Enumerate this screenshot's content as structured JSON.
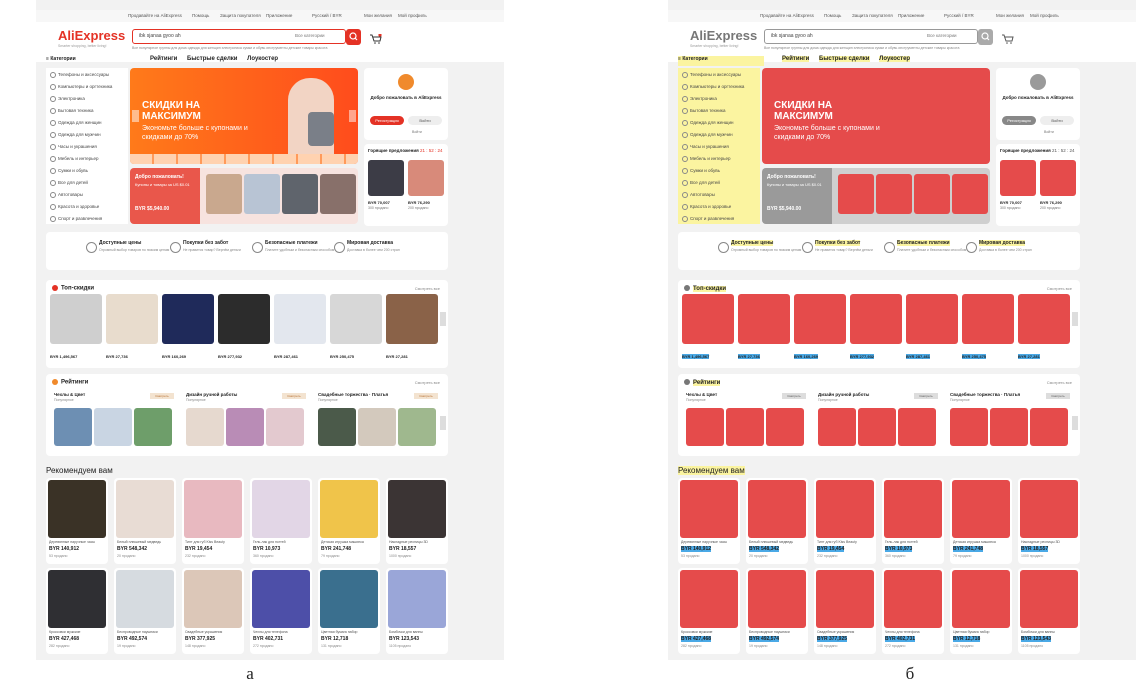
{
  "captions": {
    "a": "а",
    "b": "б"
  },
  "topbar": {
    "items": [
      "Продавайте на AliExpress",
      "Помощь",
      "Защита покупателя",
      "Приложение",
      "Русский / BYR",
      "Мои желания",
      "Мой профиль"
    ]
  },
  "header": {
    "logo": "AliExpress",
    "tagline": "Smarter shopping, better living!",
    "search_value": "ibk sjanaa gyoo ah",
    "search_category": "Все категории",
    "hints": "Все популярное  группы для дома  одежда для женщин  электроника  сумки и обувь  инструменты  детские товары  красота"
  },
  "categories": {
    "title": "Категории",
    "items": [
      "Телефоны и аксессуары",
      "Компьютеры и оргтехника",
      "Электроника",
      "Бытовая техника",
      "Одежда для женщин",
      "Одежда для мужчин",
      "Часы и украшения",
      "Мебель и интерьер",
      "Сумки и обувь",
      "Все для детей",
      "Автотовары",
      "Красота и здоровье",
      "Спорт и развлечения"
    ]
  },
  "tabs": [
    "Рейтинги",
    "Быстрые сделки",
    "Лоукостер"
  ],
  "banner": {
    "title": "СКИДКИ НА МАКСИМУМ",
    "subtitle": "Экономьте больше с купонами и скидками до 70%"
  },
  "welcome_promo": {
    "title": "Добро пожаловать!",
    "subtitle": "Купоны и товары за US $0.01",
    "price_currency": "BYR",
    "price": "$5,940.00"
  },
  "user": {
    "welcome": "Добро пожаловать в AliExpress",
    "register": "Регистрация",
    "login": "Войти",
    "other": "Войти"
  },
  "deals": {
    "title": "Горящие предложения",
    "timer": "21 : 52 : 24",
    "items": [
      {
        "price": "BYR 70,007",
        "sold": "300 продано"
      },
      {
        "price": "BYR 76,290",
        "sold": "200 продано"
      }
    ]
  },
  "features": [
    {
      "title": "Доступные цены",
      "desc": "Огромный выбор товаров по низким ценам"
    },
    {
      "title": "Покупки без забот",
      "desc": "Не нравится товар? Вернём деньги"
    },
    {
      "title": "Безопасные платежи",
      "desc": "Платите удобным и безопасным способом"
    },
    {
      "title": "Мировая доставка",
      "desc": "Доставка в более чем 200 стран"
    }
  ],
  "top_discounts": {
    "title": "Топ-скидки",
    "show_all": "Смотреть все",
    "prices": [
      "BYR 1,496,567",
      "BYR 27,736",
      "BYR 160,269",
      "BYR 277,932",
      "BYR 287,461",
      "BYR 250,475",
      "BYR 27,281"
    ]
  },
  "ratings": {
    "title": "Рейтинги",
    "show_all": "Смотреть все",
    "cards": [
      {
        "title": "Чехлы & Цвет",
        "sub": "Популярное"
      },
      {
        "title": "Дизайн ручной работы",
        "sub": "Популярное"
      },
      {
        "title": "Свадебные торжества · Платья",
        "sub": "Популярное"
      }
    ],
    "badge": "Смотреть"
  },
  "recommended": {
    "title": "Рекомендуем вам",
    "row1": [
      {
        "name": "Деревянные наручные часы",
        "price": "BYR 140,912",
        "sold": "53 продано"
      },
      {
        "name": "Белый плюшевый медведь",
        "price": "BYR 548,342",
        "sold": "20 продано"
      },
      {
        "name": "Тинт для губ Kiss Beauty",
        "price": "BYR 19,454",
        "sold": "232 продано"
      },
      {
        "name": "Гель-лак для ногтей",
        "price": "BYR 10,973",
        "sold": "360 продано"
      },
      {
        "name": "Детская игрушка машинка",
        "price": "BYR 241,748",
        "sold": "79 продано"
      },
      {
        "name": "Накладные ресницы 3D",
        "price": "BYR 18,557",
        "sold": "1000 продано"
      }
    ],
    "row2": [
      {
        "name": "Кроссовки мужские",
        "price": "BYR 427,468",
        "sold": "282 продано"
      },
      {
        "name": "Беспроводные наушники",
        "price": "BYR 492,574",
        "sold": "19 продано"
      },
      {
        "name": "Свадебные украшения",
        "price": "BYR 377,925",
        "sold": "148 продано"
      },
      {
        "name": "Чехлы для телефона",
        "price": "BYR 402,731",
        "sold": "272 продано"
      },
      {
        "name": "Цветная бумага набор",
        "price": "BYR 12,718",
        "sold": "131 продано"
      },
      {
        "name": "Бомбочки для ванны",
        "price": "BYR 123,543",
        "sold": "1105 продано"
      }
    ]
  },
  "colors": {
    "brand": "#e43225",
    "overlay_red": "#e54b4b",
    "overlay_yellow": "#fbf4a0",
    "overlay_blue": "#4aa9e6"
  }
}
